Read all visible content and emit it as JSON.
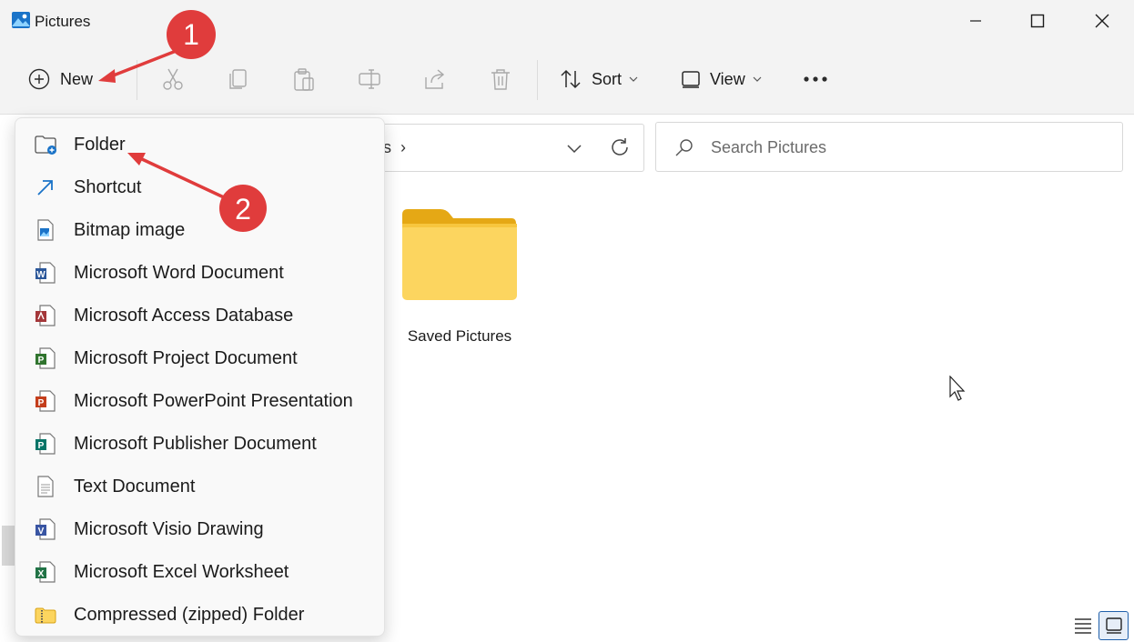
{
  "window": {
    "title": "Pictures",
    "app_icon": "pictures-app-icon",
    "controls": [
      "minimize-icon",
      "maximize-icon",
      "close-icon"
    ]
  },
  "toolbar": {
    "new_label": "New",
    "sort_label": "Sort",
    "view_label": "View",
    "icons": [
      "plus-circle-icon",
      "cut-icon",
      "copy-icon",
      "paste-icon",
      "rename-icon",
      "share-icon",
      "delete-icon",
      "sort-icon",
      "view-icon",
      "more-icon"
    ]
  },
  "address": {
    "crumb_tail": "s",
    "crumb_sep": "›"
  },
  "search": {
    "placeholder": "Search Pictures"
  },
  "content": {
    "folders": [
      {
        "label": "Saved Pictures",
        "icon": "folder-icon"
      }
    ]
  },
  "new_menu": {
    "items": [
      {
        "label": "Folder",
        "icon": "new-folder-icon"
      },
      {
        "label": "Shortcut",
        "icon": "shortcut-icon"
      },
      {
        "label": "Bitmap image",
        "icon": "bitmap-icon"
      },
      {
        "label": "Microsoft Word Document",
        "icon": "word-icon"
      },
      {
        "label": "Microsoft Access Database",
        "icon": "access-icon"
      },
      {
        "label": "Microsoft Project Document",
        "icon": "project-icon"
      },
      {
        "label": "Microsoft PowerPoint Presentation",
        "icon": "powerpoint-icon"
      },
      {
        "label": "Microsoft Publisher Document",
        "icon": "publisher-icon"
      },
      {
        "label": "Text Document",
        "icon": "text-document-icon"
      },
      {
        "label": "Microsoft Visio Drawing",
        "icon": "visio-icon"
      },
      {
        "label": "Microsoft Excel Worksheet",
        "icon": "excel-icon"
      },
      {
        "label": "Compressed (zipped) Folder",
        "icon": "zip-folder-icon"
      }
    ]
  },
  "annotations": [
    {
      "number": "1"
    },
    {
      "number": "2"
    }
  ],
  "colors": {
    "accent": "#1f5faa",
    "badge": "#e03c3c",
    "folder": "#f8cc4a",
    "toolbar_bg": "#f3f3f3"
  }
}
